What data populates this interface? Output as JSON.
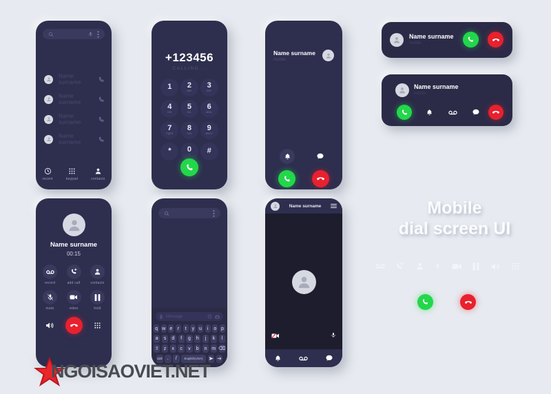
{
  "page": {
    "background": "#e7eaf0",
    "title_line1": "Mobile",
    "title_line2": "dial screen UI",
    "watermark": "NGOISAOVIET.NET"
  },
  "colors": {
    "phone_bg": "#2e2e4f",
    "surface": "#3a3a5f",
    "accent_green": "#23d74b",
    "accent_red": "#e8212e",
    "muted_text": "#4a4a72"
  },
  "contacts_screen": {
    "search_placeholder": "",
    "icons": {
      "search": "search-icon",
      "mic": "mic-icon",
      "menu": "more-vert-icon"
    },
    "contacts": [
      {
        "name": "Name surname",
        "action": "call-icon"
      },
      {
        "name": "Name surname",
        "action": "call-icon"
      },
      {
        "name": "Name surname",
        "action": "call-icon"
      },
      {
        "name": "Name surname",
        "action": "call-icon"
      }
    ],
    "nav": [
      {
        "label": "recent",
        "icon": "clock-icon"
      },
      {
        "label": "keypad",
        "icon": "keypad-icon"
      },
      {
        "label": "contacts",
        "icon": "person-icon"
      }
    ]
  },
  "dial_screen": {
    "number": "+123456",
    "status": "CALLING...",
    "keys": [
      {
        "digit": "1",
        "sub": ""
      },
      {
        "digit": "2",
        "sub": "ABC"
      },
      {
        "digit": "3",
        "sub": "DEF"
      },
      {
        "digit": "4",
        "sub": "GHI"
      },
      {
        "digit": "5",
        "sub": "JKL"
      },
      {
        "digit": "6",
        "sub": "MNO"
      },
      {
        "digit": "7",
        "sub": "PQRS"
      },
      {
        "digit": "8",
        "sub": "TUV"
      },
      {
        "digit": "9",
        "sub": "WXYZ"
      },
      {
        "digit": "*",
        "sub": ""
      },
      {
        "digit": "0",
        "sub": "+"
      },
      {
        "digit": "#",
        "sub": ""
      }
    ],
    "call_button": "call-icon"
  },
  "incoming_screen": {
    "name": "Name surname",
    "subtitle": "mobile",
    "actions": [
      {
        "icon": "bell-icon"
      },
      {
        "icon": "message-icon"
      }
    ],
    "accept": "call-icon",
    "decline": "call-end-icon"
  },
  "banner_small": {
    "name": "Name surname",
    "subtitle": "mobile",
    "accept": "call-icon",
    "decline": "call-end-icon"
  },
  "banner_large": {
    "name": "Name surname",
    "subtitle": "mobile",
    "actions": [
      {
        "icon": "call-icon",
        "style": "green"
      },
      {
        "icon": "bell-icon",
        "style": "plain"
      },
      {
        "icon": "voicemail-icon",
        "style": "plain"
      },
      {
        "icon": "message-icon",
        "style": "plain"
      },
      {
        "icon": "call-end-icon",
        "style": "red"
      }
    ]
  },
  "incall_screen": {
    "name": "Name surname",
    "timer": "00:15",
    "row1": [
      {
        "label": "record",
        "icon": "voicemail-icon"
      },
      {
        "label": "add call",
        "icon": "add-call-icon"
      },
      {
        "label": "contacts",
        "icon": "person-icon"
      }
    ],
    "row2": [
      {
        "label": "mute",
        "icon": "mic-off-icon"
      },
      {
        "label": "video",
        "icon": "video-icon"
      },
      {
        "label": "hold",
        "icon": "pause-icon"
      }
    ],
    "row3": [
      {
        "icon": "speaker-icon"
      },
      {
        "icon": "call-end-icon"
      },
      {
        "icon": "keypad-icon"
      }
    ]
  },
  "keyboard_screen": {
    "search_placeholder": "",
    "message_placeholder": "Message",
    "input_icons": {
      "attach": "paperclip-icon",
      "emoji": "emoji-icon",
      "camera": "camera-icon"
    },
    "rows": [
      [
        "q",
        "w",
        "e",
        "r",
        "t",
        "y",
        "u",
        "i",
        "o",
        "p"
      ],
      [
        "a",
        "s",
        "d",
        "f",
        "g",
        "h",
        "j",
        "k",
        "l"
      ],
      [
        "⇧",
        "z",
        "x",
        "c",
        "v",
        "b",
        "n",
        "m",
        "⌫"
      ]
    ],
    "bottom_row": {
      "numeric": "123",
      "period": ".",
      "slash": "/",
      "language": "English(USA)",
      "send": "send-icon",
      "enter": "enter-icon"
    }
  },
  "video_screen": {
    "name": "Name surname",
    "menu_icon": "hamburger-icon",
    "overlay_icons": [
      {
        "icon": "video-off-icon"
      },
      {
        "icon": "mic-icon"
      }
    ],
    "bottom_icons": [
      {
        "icon": "bell-icon"
      },
      {
        "icon": "voicemail-icon"
      },
      {
        "icon": "message-icon"
      }
    ]
  },
  "icon_strip": {
    "icons": [
      {
        "icon": "voicemail-icon"
      },
      {
        "icon": "add-call-icon"
      },
      {
        "icon": "person-icon"
      },
      {
        "icon": "mic-icon"
      },
      {
        "icon": "video-icon"
      },
      {
        "icon": "pause-icon"
      },
      {
        "icon": "speaker-icon"
      },
      {
        "icon": "keypad-icon"
      }
    ],
    "accept": "call-icon",
    "decline": "call-end-icon"
  }
}
